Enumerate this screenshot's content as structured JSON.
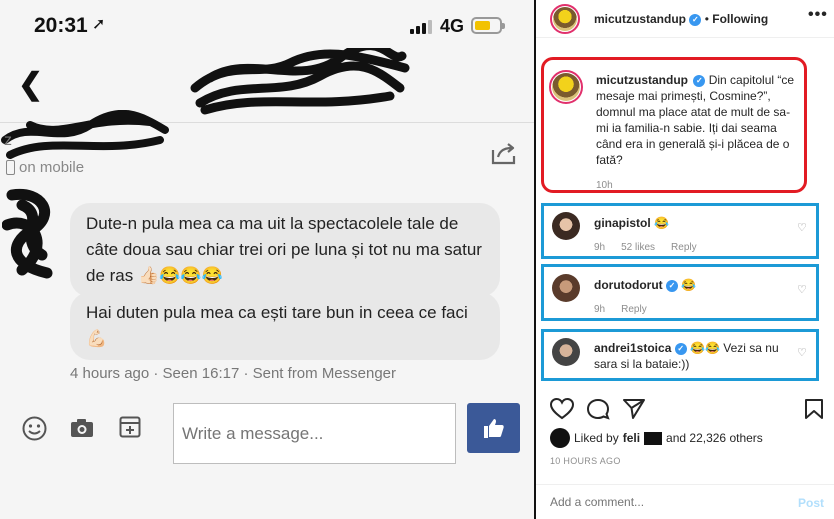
{
  "messenger": {
    "status_bar": {
      "time": "20:31",
      "network": "4G"
    },
    "contact": {
      "name_initial": "z",
      "presence": "on mobile"
    },
    "messages": [
      {
        "text": "Dute-n pula mea ca ma uit la spectacolele tale de câte doua sau chiar trei ori pe luna și tot nu ma satur de ras 👍🏻😂😂😂"
      },
      {
        "text": "Hai duten pula mea ca ești tare bun in ceea ce faci 💪🏻"
      }
    ],
    "meta": "4 hours ago · Seen 16:17 · Sent from Messenger",
    "composer": {
      "placeholder": "Write a message..."
    },
    "icons": [
      "back-icon",
      "share-icon",
      "emoji-icon",
      "camera-icon",
      "add-icon",
      "like-icon"
    ]
  },
  "instagram": {
    "header": {
      "username": "micutzustandup",
      "following_label": "Following"
    },
    "caption": {
      "username": "micutzustandup",
      "text": "Din capitolul “ce mesaje mai primești, Cosmine?”, domnul ma place atat de mult de sa-mi ia familia-n sabie. Iți dai seama când era in generală și-i plăcea de o fată?",
      "time": "10h"
    },
    "comments": [
      {
        "username": "ginapistol",
        "text": "😂",
        "time": "9h",
        "likes": "52 likes",
        "reply": "Reply"
      },
      {
        "username": "dorutodorut",
        "text": "😂",
        "time": "9h",
        "likes": "",
        "reply": "Reply"
      },
      {
        "username": "andrei1stoica",
        "text": "😂😂 Vezi sa nu sara si la bataie:))",
        "time": "",
        "likes": "",
        "reply": ""
      }
    ],
    "liked_by": {
      "prefix": "Liked by",
      "name": "feli",
      "suffix": "and 22,326 others"
    },
    "post_age": "10 HOURS AGO",
    "add_comment": {
      "placeholder": "Add a comment...",
      "post_label": "Post"
    },
    "colors": {
      "highlight_red": "#e21b23",
      "highlight_blue": "#1c9ad6",
      "verified": "#3897f0"
    }
  }
}
